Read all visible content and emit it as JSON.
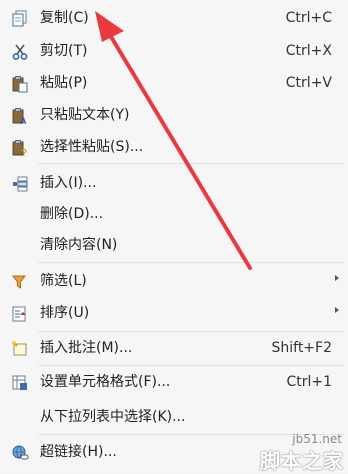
{
  "menu": {
    "items": [
      {
        "label": "复制(C)",
        "shortcut": "Ctrl+C",
        "icon": "copy-icon"
      },
      {
        "label": "剪切(T)",
        "shortcut": "Ctrl+X",
        "icon": "scissors-icon"
      },
      {
        "label": "粘贴(P)",
        "shortcut": "Ctrl+V",
        "icon": "paste-icon"
      },
      {
        "label": "只粘贴文本(Y)",
        "shortcut": "",
        "icon": "paste-text-icon"
      },
      {
        "label": "选择性粘贴(S)...",
        "shortcut": "",
        "icon": "paste-special-icon"
      },
      {
        "label": "插入(I)...",
        "shortcut": "",
        "icon": "insert-icon"
      },
      {
        "label": "删除(D)...",
        "shortcut": "",
        "icon": ""
      },
      {
        "label": "清除内容(N)",
        "shortcut": "",
        "icon": ""
      },
      {
        "label": "筛选(L)",
        "shortcut": "",
        "icon": "filter-icon",
        "submenu": true
      },
      {
        "label": "排序(U)",
        "shortcut": "",
        "icon": "sort-icon",
        "submenu": true
      },
      {
        "label": "插入批注(M)...",
        "shortcut": "Shift+F2",
        "icon": "comment-icon"
      },
      {
        "label": "设置单元格格式(F)...",
        "shortcut": "Ctrl+1",
        "icon": "format-cells-icon"
      },
      {
        "label": "从下拉列表中选择(K)...",
        "shortcut": "",
        "icon": ""
      },
      {
        "label": "超链接(H)...",
        "shortcut": "",
        "icon": "hyperlink-icon"
      }
    ]
  },
  "watermark": {
    "domain": "jb51.net",
    "site": "脚本之家"
  },
  "colors": {
    "annotation_arrow": "#e83a3f",
    "menu_background": "#f6f6f6"
  }
}
